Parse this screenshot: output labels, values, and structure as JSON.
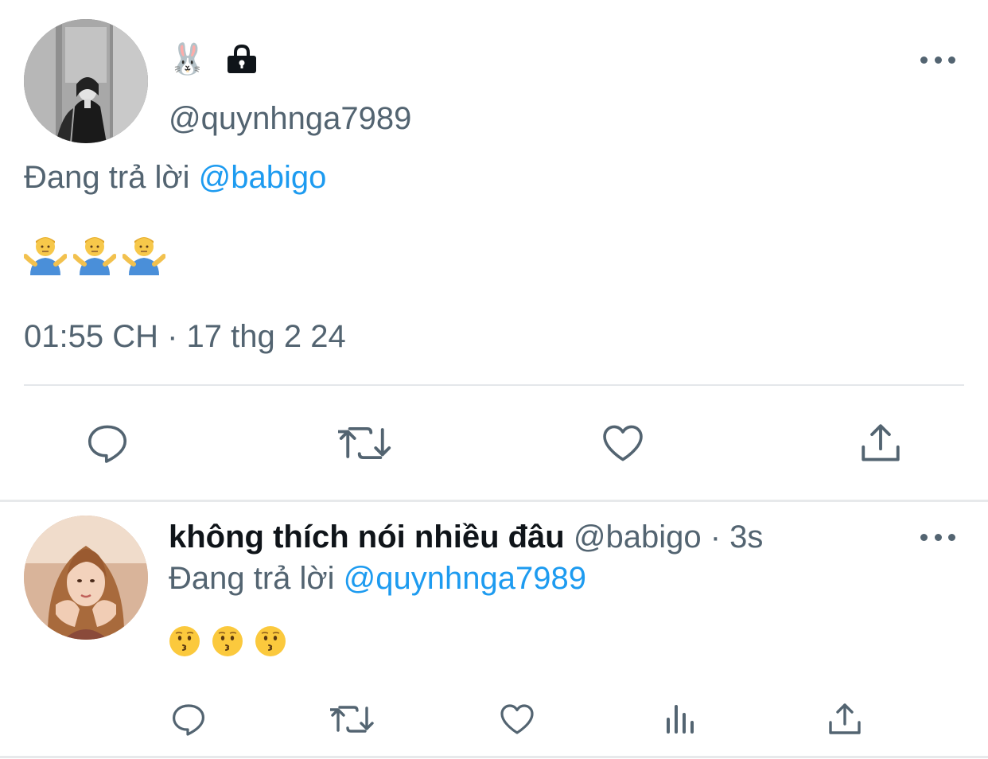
{
  "tweet": {
    "name_emoji": "🐰",
    "handle": "@quynhnga7989",
    "reply_prefix": "Đang trả lời",
    "reply_to": "@babigo",
    "content_emojis": [
      "🤷‍♂️",
      "🤷‍♂️",
      "🤷‍♂️"
    ],
    "timestamp": "01:55 CH · 17 thg 2 24",
    "actions": [
      "reply-icon",
      "retweet-icon",
      "like-icon",
      "share-icon"
    ]
  },
  "reply": {
    "display_name": "không thích nói nhiều đâu",
    "handle": "@babigo",
    "separator": "·",
    "time_ago": "3s",
    "reply_prefix": "Đang trả lời",
    "reply_to": "@quynhnga7989",
    "content_emojis": [
      "😗",
      "😗",
      "😗"
    ],
    "actions": [
      "reply-icon",
      "retweet-icon",
      "like-icon",
      "analytics-icon",
      "share-icon"
    ]
  },
  "colors": {
    "text_primary": "#0f1419",
    "text_secondary": "#536471",
    "link": "#1d9bf0",
    "divider": "#e7e9eb"
  }
}
